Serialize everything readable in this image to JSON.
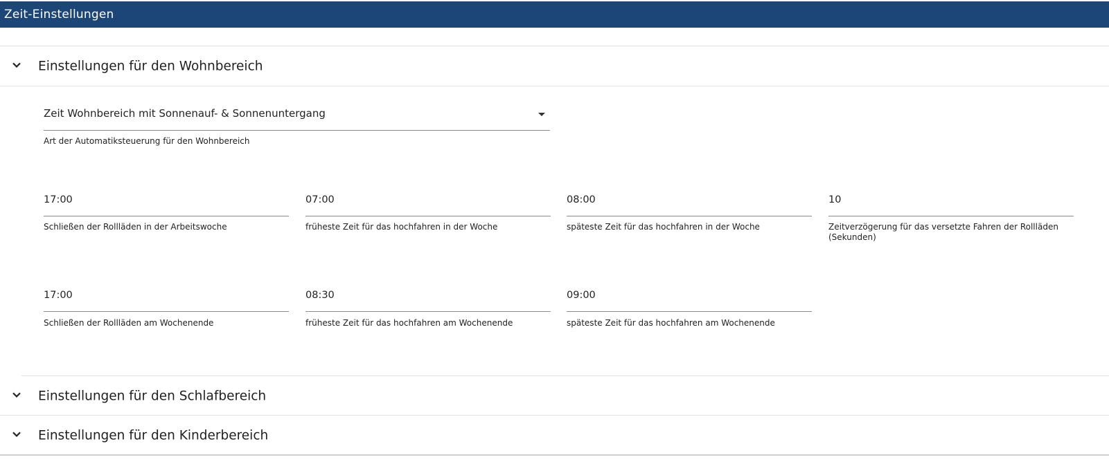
{
  "window": {
    "title": "Zeit-Einstellungen"
  },
  "sections": [
    {
      "title": "Einstellungen für den Wohnbereich"
    },
    {
      "title": "Einstellungen für den Schlafbereich"
    },
    {
      "title": "Einstellungen für den Kinderbereich"
    }
  ],
  "wohnbereich": {
    "mode_select": {
      "value": "Zeit Wohnbereich mit Sonnenauf- & Sonnenuntergang",
      "helper": "Art der Automatiksteuerung für den Wohnbereich"
    },
    "fields_row1": [
      {
        "value": "17:00",
        "helper": "Schließen der Rollläden in der Arbeitswoche"
      },
      {
        "value": "07:00",
        "helper": "frühest e Zeit für das hochfahren in der Woche"
      },
      {
        "value": "08:00",
        "helper": "späteste Zeit für das hochfahren in der Woche"
      },
      {
        "value": "10",
        "helper": "Zeitverzögerung für das versetzte Fahren der Rollläden (Sekunden)"
      }
    ],
    "fields_row2": [
      {
        "value": "17:00",
        "helper": "Schließen der Rollläden am Wochenende"
      },
      {
        "value": "08:30",
        "helper": "früheste Zeit für das hochfahren am Wochenende"
      },
      {
        "value": "09:00",
        "helper": "späteste Zeit für das hochfahren am Wochenende"
      }
    ]
  },
  "icons": {
    "chevron": "chevron-down-icon",
    "dropdown": "dropdown-arrow-icon"
  },
  "colors": {
    "titlebar": "#1c4677",
    "underline": "#8a8a8a"
  }
}
